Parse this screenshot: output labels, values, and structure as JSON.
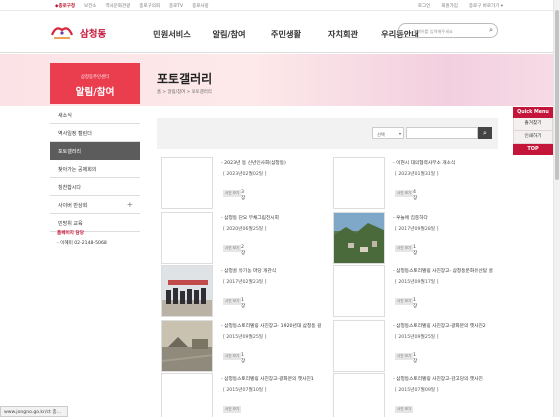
{
  "topbar": {
    "left": [
      "◆종로구청",
      "보건소",
      "역사문화관광",
      "종로구의회",
      "종로TV",
      "종로사랑"
    ],
    "right": [
      "로그인",
      "회원가입",
      "종로구 바로가기 ▾"
    ]
  },
  "header": {
    "site_name": "삼청동",
    "nav": [
      "민원서비스",
      "알림/참여",
      "주민생활",
      "자치회관",
      "우리동안내"
    ],
    "search_placeholder": "검색어를 입력해주세요",
    "search_icon": "magnifier-icon"
  },
  "sidebar": {
    "subtitle": "삼청동주민센터",
    "title": "알림/참여",
    "items": [
      {
        "label": "새소식",
        "active": false,
        "plus": false
      },
      {
        "label": "역사일정 캘린더",
        "active": false,
        "plus": false
      },
      {
        "label": "포토갤러리",
        "active": true,
        "plus": false
      },
      {
        "label": "찾아가는 공제회의",
        "active": false,
        "plus": false
      },
      {
        "label": "칭찬합시다",
        "active": false,
        "plus": false
      },
      {
        "label": "사이버 반상회",
        "active": false,
        "plus": true
      },
      {
        "label": "민방위 교육",
        "active": false,
        "plus": false
      }
    ],
    "person_title": "홈페이지 담당",
    "person_phone": "- 이혜미 02-2148-5068"
  },
  "content": {
    "title": "포토갤러리",
    "breadcrumb": "홈  >  알림/참여  >  포토갤러리",
    "select_label": "선택",
    "search_button_icon": "magnifier-icon"
  },
  "gallery": [
    {
      "title": "- 2023년 동 신년인사회(삼청동)",
      "date": "[ 2023년02월02일 ]",
      "badge": "사진 보기",
      "count": "3장",
      "thumb": "blank"
    },
    {
      "title": "- 이현시 대의협력사무소 개소식",
      "date": "[ 2023년01월31일 ]",
      "badge": "사진 보기",
      "count": "4장",
      "thumb": "blank"
    },
    {
      "title": "- 삼청동 단오 부채그림전시회",
      "date": "[ 2020년06월25일 ]",
      "badge": "사진 보기",
      "count": "2장",
      "thumb": "blank"
    },
    {
      "title": "- 우놀에 집중하다",
      "date": "[ 2017년09월28일 ]",
      "badge": "사진 보기",
      "count": "1장",
      "thumb": "landscape"
    },
    {
      "title": "- 삼청골 유기농 마당 개관식",
      "date": "[ 2017년02월23일 ]",
      "badge": "사진 보기",
      "count": "1장",
      "thumb": "group"
    },
    {
      "title": "- 삼청동스토리텔링 사진장고- 삼청동문화유산탐 골",
      "date": "[ 2015년09월17일 ]",
      "badge": "사진 보기",
      "count": "1장",
      "thumb": "blank"
    },
    {
      "title": "- 삼청동스토리텔링 사진장고- 1920년대 삼청동 길",
      "date": "[ 2015년09월25일 ]",
      "badge": "사진 보기",
      "count": "1장",
      "thumb": "old"
    },
    {
      "title": "- 삼청동스토리텔링 사진장고-광화문의 옛사진2",
      "date": "[ 2015년09월25일 ]",
      "badge": "사진 보기",
      "count": "1장",
      "thumb": "blank"
    },
    {
      "title": "- 삼청동스토리텔링 사진장고-광화문의 옛사진1",
      "date": "[ 2015년07월10일 ]",
      "badge": "사진 보기",
      "count": "",
      "thumb": "blank"
    },
    {
      "title": "- 삼청동스토리텔링 사진장고-감고당의 옛사진",
      "date": "[ 2015년07월09일 ]",
      "badge": "사진 보기",
      "count": "",
      "thumb": "blank"
    }
  ],
  "quick_menu": {
    "title": "Quick Menu",
    "items": [
      "즐겨찾기",
      "인쇄하기"
    ],
    "top": "TOP"
  },
  "status_url": "www.jongno.go.kr/ct 종..."
}
